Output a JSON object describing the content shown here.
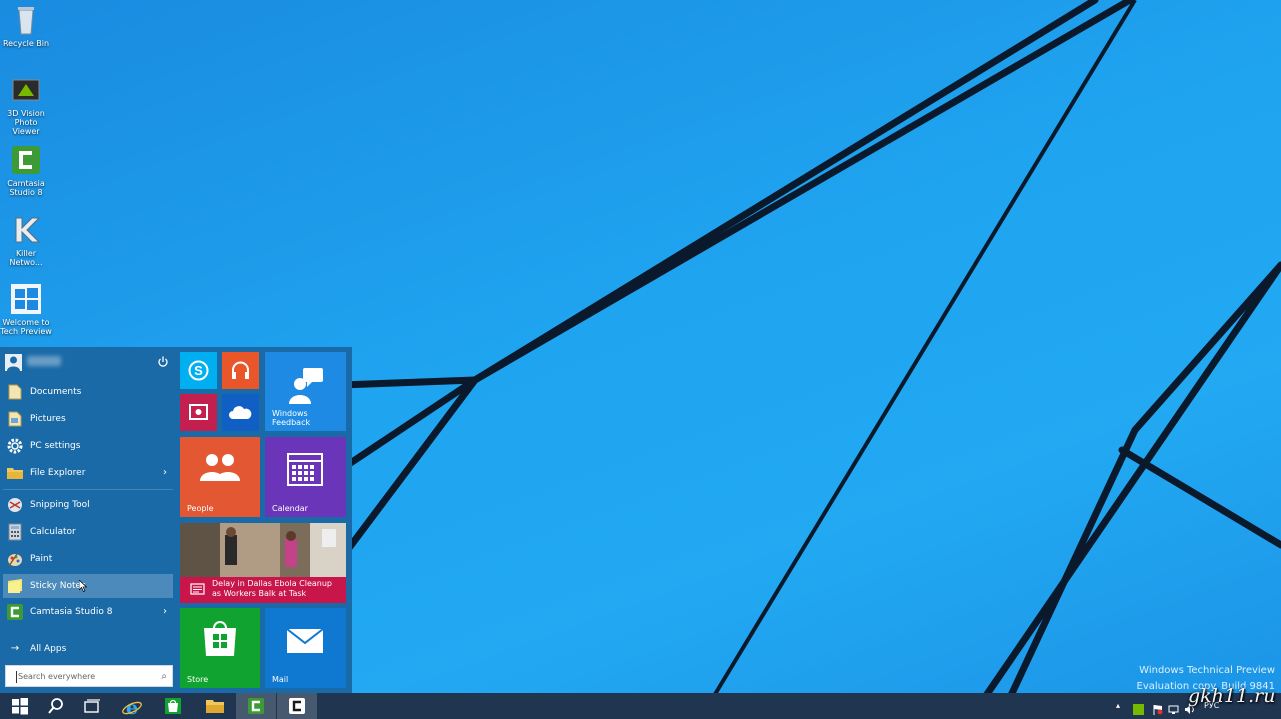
{
  "desktop": {
    "icons": [
      {
        "label": "Recycle Bin"
      },
      {
        "label": "3D Vision Photo Viewer"
      },
      {
        "label": "Camtasia Studio 8"
      },
      {
        "label": "Killer Netwo..."
      },
      {
        "label": "Welcome to Tech Preview"
      }
    ]
  },
  "start_menu": {
    "power_icon": "power-icon",
    "pinned": [
      {
        "label": "Documents",
        "icon": "documents-icon"
      },
      {
        "label": "Pictures",
        "icon": "pictures-icon"
      },
      {
        "label": "PC settings",
        "icon": "gear-icon"
      },
      {
        "label": "File Explorer",
        "icon": "folder-icon",
        "arrow": ">"
      }
    ],
    "recent": [
      {
        "label": "Snipping Tool",
        "icon": "scissors-icon"
      },
      {
        "label": "Calculator",
        "icon": "calculator-icon"
      },
      {
        "label": "Paint",
        "icon": "paint-icon"
      },
      {
        "label": "Sticky Notes",
        "icon": "sticky-notes-icon"
      },
      {
        "label": "Camtasia Studio 8",
        "icon": "camtasia-icon",
        "arrow": ">"
      }
    ],
    "all_apps": "All Apps",
    "search_placeholder": "Search everywhere"
  },
  "tiles": {
    "skype": {
      "icon": "skype-icon",
      "color": "#00aff0"
    },
    "music": {
      "icon": "headphones-icon",
      "color": "#e8562a"
    },
    "video": {
      "icon": "video-icon",
      "color": "#c4204f"
    },
    "onedrive": {
      "icon": "cloud-icon",
      "color": "#0f5fc5"
    },
    "windows_feedback": {
      "label": "Windows Feedback",
      "color": "#1e8ae4"
    },
    "people": {
      "label": "People",
      "color": "#e35833"
    },
    "calendar": {
      "label": "Calendar",
      "color": "#6a35b8"
    },
    "news": {
      "headline": "Delay in Dallas Ebola Cleanup as Workers Balk at Task",
      "color": "#c8164a"
    },
    "store": {
      "label": "Store",
      "color": "#11a32f"
    },
    "mail": {
      "label": "Mail",
      "color": "#0f78d0"
    }
  },
  "watermark": {
    "line1": "Windows Technical Preview",
    "line2": "Evaluation copy. Build 9841"
  },
  "site": "gkh11.ru",
  "taskbar": {
    "buttons": [
      {
        "name": "start-button",
        "icon": "windows-logo-icon"
      },
      {
        "name": "search-button",
        "icon": "search-icon"
      },
      {
        "name": "task-view-button",
        "icon": "task-view-icon"
      },
      {
        "name": "internet-explorer-button",
        "icon": "ie-icon"
      },
      {
        "name": "store-taskbar-button",
        "icon": "store-icon"
      },
      {
        "name": "file-explorer-taskbar-button",
        "icon": "folder-icon"
      },
      {
        "name": "camtasia-taskbar-button",
        "icon": "camtasia-icon"
      },
      {
        "name": "camtasia-recorder-taskbar-button",
        "icon": "camtasia-icon"
      }
    ],
    "language": "РУС"
  }
}
